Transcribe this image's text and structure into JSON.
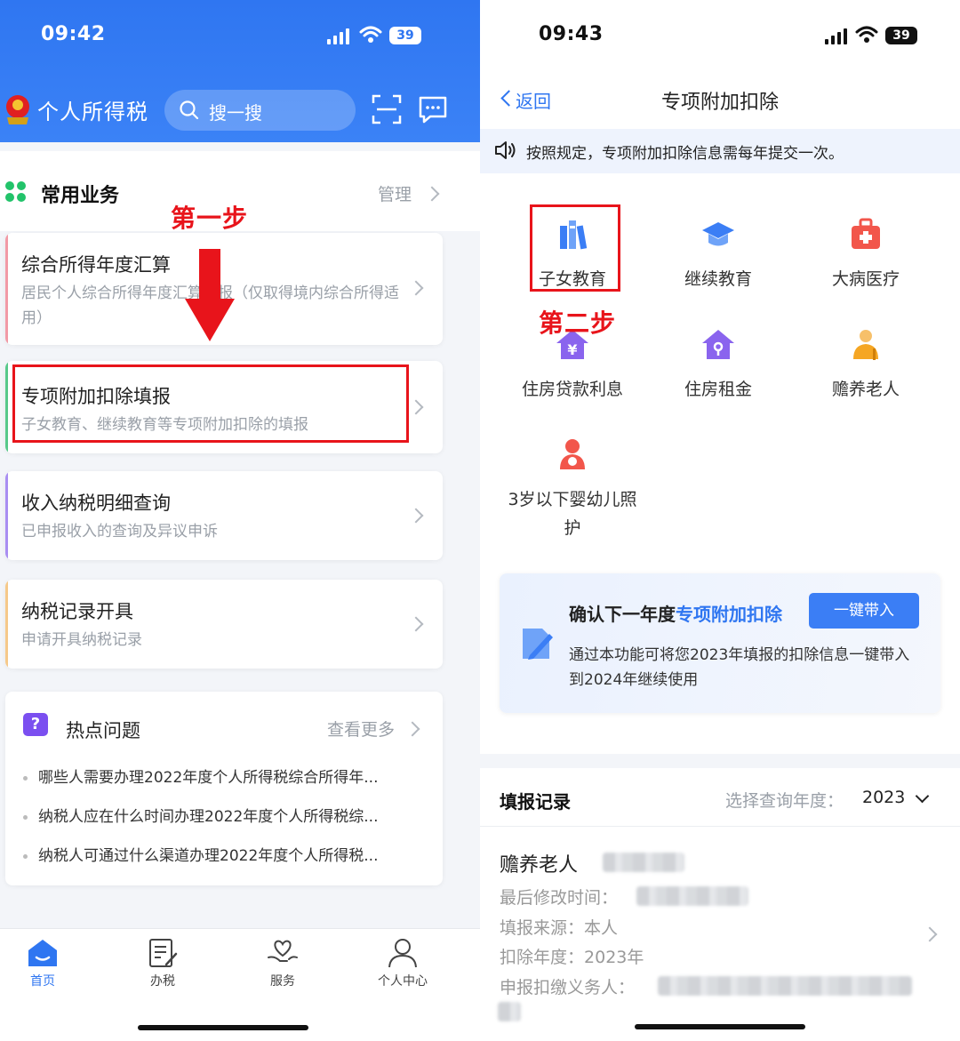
{
  "left": {
    "status": {
      "time": "09:42",
      "battery": "39"
    },
    "header": {
      "title": "个人所得税",
      "search_placeholder": "搜一搜"
    },
    "section": {
      "title": "常用业务",
      "manage": "管理"
    },
    "cards": [
      {
        "title": "综合所得年度汇算",
        "subtitle": "居民个人综合所得年度汇算申报（仅取得境内综合所得适用）",
        "accent": "#f29aa6"
      },
      {
        "title": "专项附加扣除填报",
        "subtitle": "子女教育、继续教育等专项附加扣除的填报",
        "accent": "#57c98a"
      },
      {
        "title": "收入纳税明细查询",
        "subtitle": "已申报收入的查询及异议申诉",
        "accent": "#a98ef2"
      },
      {
        "title": "纳税记录开具",
        "subtitle": "申请开具纳税记录",
        "accent": "#f6c98a"
      }
    ],
    "hot": {
      "title": "热点问题",
      "more": "查看更多",
      "items": [
        "哪些人需要办理2022年度个人所得税综合所得年...",
        "纳税人应在什么时间办理2022年度个人所得税综...",
        "纳税人可通过什么渠道办理2022年度个人所得税..."
      ]
    },
    "tabs": [
      {
        "label": "首页",
        "icon": "home-icon",
        "active": true
      },
      {
        "label": "办税",
        "icon": "edit-doc-icon",
        "active": false
      },
      {
        "label": "服务",
        "icon": "heart-hand-icon",
        "active": false
      },
      {
        "label": "个人中心",
        "icon": "user-icon",
        "active": false
      }
    ],
    "annotation": {
      "step1": "第一步"
    }
  },
  "right": {
    "status": {
      "time": "09:43",
      "battery": "39"
    },
    "nav": {
      "back": "返回",
      "title": "专项附加扣除"
    },
    "notice": "按照规定，专项附加扣除信息需每年提交一次。",
    "grid": [
      {
        "label": "子女教育",
        "icon": "books-icon",
        "color": "#3b7ef5"
      },
      {
        "label": "继续教育",
        "icon": "graduation-cap-icon",
        "color": "#3b7ef5"
      },
      {
        "label": "大病医疗",
        "icon": "medical-kit-icon",
        "color": "#f2564b"
      },
      {
        "label": "住房贷款利息",
        "icon": "house-yuan-icon",
        "color": "#8a64ee"
      },
      {
        "label": "住房租金",
        "icon": "house-key-icon",
        "color": "#8a64ee"
      },
      {
        "label": "赡养老人",
        "icon": "elderly-icon",
        "color": "#f5a623"
      },
      {
        "label": "3岁以下婴幼儿照护",
        "label_line1": "3岁以下婴幼儿照",
        "label_line2": "护",
        "icon": "mother-baby-icon",
        "color": "#f2564b"
      }
    ],
    "annotation": {
      "step2": "第二步"
    },
    "promo": {
      "title_prefix": "确认下一年度",
      "title_highlight": "专项附加扣除",
      "button": "一键带入",
      "desc": "通过本功能可将您2023年填报的扣除信息一键带入到2024年继续使用"
    },
    "records": {
      "title": "填报记录",
      "year_label": "选择查询年度：",
      "year_value": "2023",
      "item": {
        "name": "赡养老人",
        "modified_label": "最后修改时间：",
        "source_label": "填报来源：",
        "source_value": "本人",
        "year_label": "扣除年度：",
        "year_value": "2023年",
        "withholder_label": "申报扣缴义务人："
      }
    }
  },
  "colors": {
    "brand": "#2f76f1",
    "annotation": "#e8141b"
  }
}
